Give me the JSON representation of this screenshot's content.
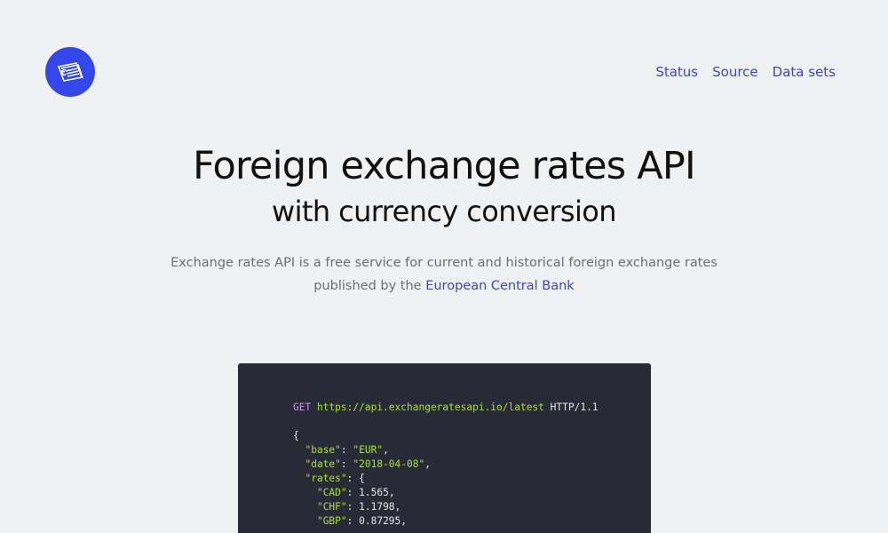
{
  "header": {
    "logo_icon": "currency-notes-icon",
    "nav": [
      {
        "label": "Status"
      },
      {
        "label": "Source"
      },
      {
        "label": "Data sets"
      }
    ]
  },
  "hero": {
    "title": "Foreign exchange rates API",
    "subtitle": "with currency conversion",
    "description_line1": "Exchange rates API is a free service for current and historical foreign exchange rates",
    "description_line2_prefix": "published by the ",
    "description_link": "European Central Bank"
  },
  "code": {
    "method": "GET",
    "url": "https://api.exchangeratesapi.io/latest",
    "protocol": " HTTP/1.1",
    "lines": [
      {
        "indent": "",
        "key": "",
        "sep": "",
        "value": "{",
        "tail": ""
      },
      {
        "indent": "  ",
        "key": "\"base\"",
        "sep": ": ",
        "value": "\"EUR\"",
        "tail": ","
      },
      {
        "indent": "  ",
        "key": "\"date\"",
        "sep": ": ",
        "value": "\"2018-04-08\"",
        "tail": ","
      },
      {
        "indent": "  ",
        "key": "\"rates\"",
        "sep": ": ",
        "value": "{",
        "tail": ""
      },
      {
        "indent": "    ",
        "key": "\"CAD\"",
        "sep": ": ",
        "value": "1.565",
        "tail": ","
      },
      {
        "indent": "    ",
        "key": "\"CHF\"",
        "sep": ": ",
        "value": "1.1798",
        "tail": ","
      },
      {
        "indent": "    ",
        "key": "\"GBP\"",
        "sep": ": ",
        "value": "0.87295",
        "tail": ","
      }
    ]
  },
  "colors": {
    "accent": "#3347ea",
    "link": "#3b48c9",
    "code_bg": "#282a36"
  }
}
